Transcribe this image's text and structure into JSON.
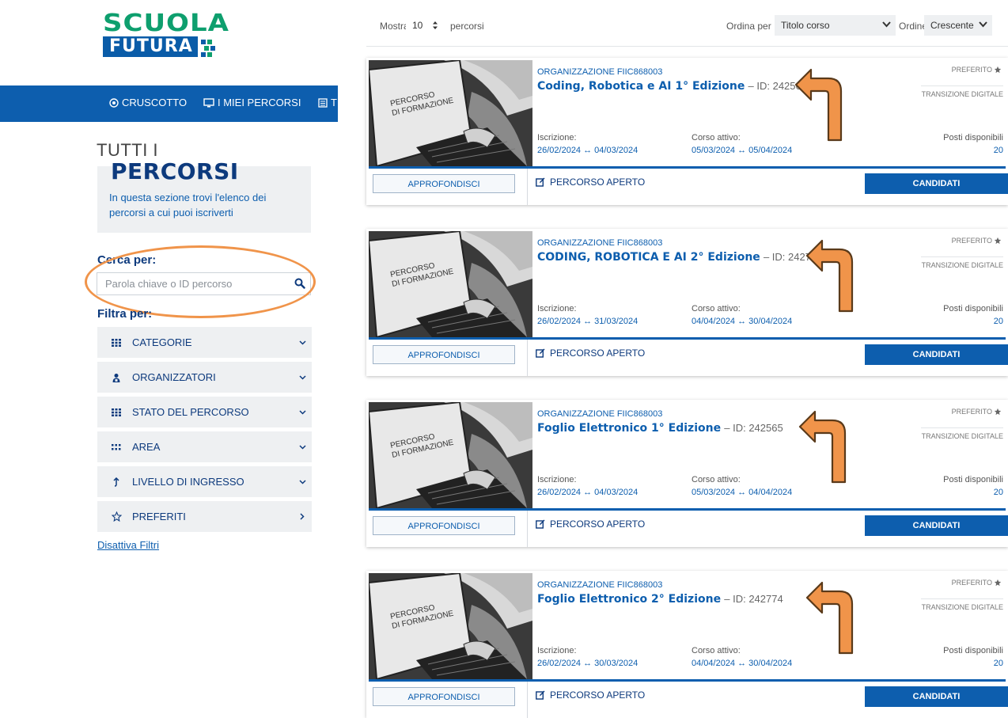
{
  "logo": {
    "line1": "SCUOLA",
    "line2": "FUTURA"
  },
  "nav": {
    "items": [
      {
        "label": "CRUSCOTTO",
        "icon": "target-icon"
      },
      {
        "label": "I MIEI PERCORSI",
        "icon": "monitor-icon"
      },
      {
        "label": "TU",
        "icon": "list-icon"
      }
    ]
  },
  "page": {
    "title_line1": "TUTTI I",
    "title_line2": "PERCORSI",
    "intro": "In questa sezione trovi l'elenco dei percorsi a cui puoi iscriverti"
  },
  "search": {
    "label": "Cerca per:",
    "placeholder": "Parola chiave o ID percorso"
  },
  "filters": {
    "label": "Filtra per:",
    "items": [
      {
        "label": "CATEGORIE",
        "icon": "grid-icon",
        "chevron": "down"
      },
      {
        "label": "ORGANIZZATORI",
        "icon": "users-icon",
        "chevron": "down"
      },
      {
        "label": "STATO DEL PERCORSO",
        "icon": "grid-icon",
        "chevron": "down"
      },
      {
        "label": "AREA",
        "icon": "dots-grid-icon",
        "chevron": "down"
      },
      {
        "label": "LIVELLO DI INGRESSO",
        "icon": "arrow-up-icon",
        "chevron": "down"
      },
      {
        "label": "PREFERITI",
        "icon": "star-outline-icon",
        "chevron": "right"
      }
    ],
    "disable_label": "Disattiva Filtri"
  },
  "toolbar": {
    "show_label": "Mostra",
    "show_value": "10",
    "show_suffix": "percorsi",
    "sort_label": "Ordina per",
    "sort_value": "Titolo corso",
    "order_label": "Ordine",
    "order_value": "Crescente"
  },
  "card_common": {
    "image_text_1": "PERCORSO",
    "image_text_2": "DI FORMAZIONE",
    "favorite_label": "PREFERITO",
    "iscrizione_label": "Iscrizione:",
    "corso_label": "Corso attivo:",
    "posti_label": "Posti disponibili",
    "details_button": "APPROFONDISCI",
    "open_label": "PERCORSO APERTO",
    "apply_button": "CANDIDATI"
  },
  "cards": [
    {
      "org": "ORGANIZZAZIONE FIIC868003",
      "title": "Coding, Robotica e AI 1° Edizione",
      "id": "– ID: 242564",
      "category": "TRANSIZIONE DIGITALE",
      "iscrizione": "26/02/2024 ↔ 04/03/2024",
      "corso": "05/03/2024 ↔ 05/04/2024",
      "posti": "20"
    },
    {
      "org": "ORGANIZZAZIONE FIIC868003",
      "title": "CODING, ROBOTICA E AI 2° Edizione",
      "id": "– ID: 242772",
      "category": "TRANSIZIONE DIGITALE",
      "iscrizione": "26/02/2024 ↔ 31/03/2024",
      "corso": "04/04/2024 ↔ 30/04/2024",
      "posti": "20"
    },
    {
      "org": "ORGANIZZAZIONE FIIC868003",
      "title": "Foglio Elettronico 1° Edizione",
      "id": "– ID: 242565",
      "category": "TRANSIZIONE DIGITALE",
      "iscrizione": "26/02/2024 ↔ 04/03/2024",
      "corso": "05/03/2024 ↔ 04/04/2024",
      "posti": "20"
    },
    {
      "org": "ORGANIZZAZIONE FIIC868003",
      "title": "Foglio Elettronico 2° Edizione",
      "id": "– ID: 242774",
      "category": "TRANSIZIONE DIGITALE",
      "iscrizione": "26/02/2024 ↔ 30/03/2024",
      "corso": "04/04/2024 ↔ 30/04/2024",
      "posti": "20"
    }
  ],
  "colors": {
    "primary": "#0d5eae",
    "dark_blue": "#0d3a7d",
    "accent_orange": "#f0944a",
    "logo_green": "#0e9f6e"
  }
}
